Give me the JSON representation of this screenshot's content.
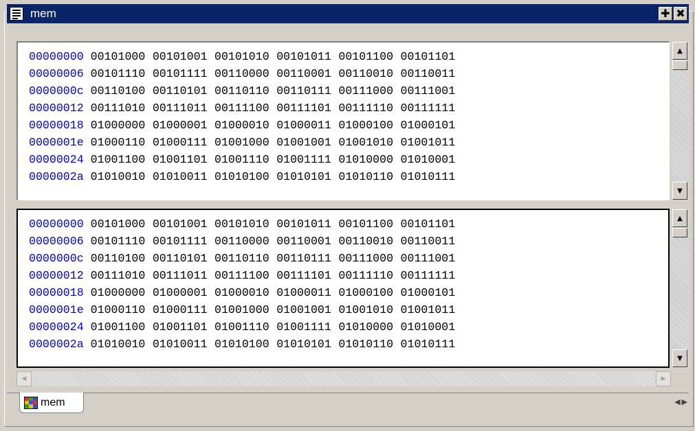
{
  "window": {
    "title": "mem",
    "add_button": "✚",
    "close_button": "✖"
  },
  "top_pane": {
    "rows": [
      {
        "addr": "00000000",
        "bytes": [
          "00101000",
          "00101001",
          "00101010",
          "00101011",
          "00101100",
          "00101101"
        ]
      },
      {
        "addr": "00000006",
        "bytes": [
          "00101110",
          "00101111",
          "00110000",
          "00110001",
          "00110010",
          "00110011"
        ]
      },
      {
        "addr": "0000000c",
        "bytes": [
          "00110100",
          "00110101",
          "00110110",
          "00110111",
          "00111000",
          "00111001"
        ]
      },
      {
        "addr": "00000012",
        "bytes": [
          "00111010",
          "00111011",
          "00111100",
          "00111101",
          "00111110",
          "00111111"
        ]
      },
      {
        "addr": "00000018",
        "bytes": [
          "01000000",
          "01000001",
          "01000010",
          "01000011",
          "01000100",
          "01000101"
        ]
      },
      {
        "addr": "0000001e",
        "bytes": [
          "01000110",
          "01000111",
          "01001000",
          "01001001",
          "01001010",
          "01001011"
        ]
      },
      {
        "addr": "00000024",
        "bytes": [
          "01001100",
          "01001101",
          "01001110",
          "01001111",
          "01010000",
          "01010001"
        ]
      },
      {
        "addr": "0000002a",
        "bytes": [
          "01010010",
          "01010011",
          "01010100",
          "01010101",
          "01010110",
          "01010111"
        ]
      }
    ]
  },
  "bottom_pane": {
    "rows": [
      {
        "addr": "00000000",
        "bytes": [
          "00101000",
          "00101001",
          "00101010",
          "00101011",
          "00101100",
          "00101101"
        ]
      },
      {
        "addr": "00000006",
        "bytes": [
          "00101110",
          "00101111",
          "00110000",
          "00110001",
          "00110010",
          "00110011"
        ]
      },
      {
        "addr": "0000000c",
        "bytes": [
          "00110100",
          "00110101",
          "00110110",
          "00110111",
          "00111000",
          "00111001"
        ]
      },
      {
        "addr": "00000012",
        "bytes": [
          "00111010",
          "00111011",
          "00111100",
          "00111101",
          "00111110",
          "00111111"
        ]
      },
      {
        "addr": "00000018",
        "bytes": [
          "01000000",
          "01000001",
          "01000010",
          "01000011",
          "01000100",
          "01000101"
        ]
      },
      {
        "addr": "0000001e",
        "bytes": [
          "01000110",
          "01000111",
          "01001000",
          "01001001",
          "01001010",
          "01001011"
        ]
      },
      {
        "addr": "00000024",
        "bytes": [
          "01001100",
          "01001101",
          "01001110",
          "01001111",
          "01010000",
          "01010001"
        ]
      },
      {
        "addr": "0000002a",
        "bytes": [
          "01010010",
          "01010011",
          "01010100",
          "01010101",
          "01010110",
          "01010111"
        ]
      }
    ]
  },
  "tabs": [
    {
      "label": "mem",
      "icon": "grid-icon"
    }
  ],
  "icons": {
    "title": "document-icon",
    "scroll_up": "arrow-up-icon",
    "scroll_down": "arrow-down-icon",
    "scroll_left": "arrow-left-icon",
    "scroll_right": "arrow-right-icon"
  },
  "colors": {
    "titlebar": "#0a246a",
    "address": "#0000cc"
  }
}
